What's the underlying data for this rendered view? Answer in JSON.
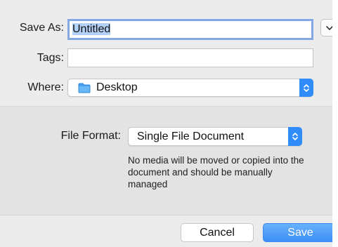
{
  "dialog": {
    "save_as_label": "Save As:",
    "save_as_value": "Untitled",
    "tags_label": "Tags:",
    "tags_value": "",
    "where_label": "Where:",
    "where_value": "Desktop",
    "where_icon": "folder-icon"
  },
  "options": {
    "file_format_label": "File Format:",
    "file_format_value": "Single File Document",
    "note": "No media will be moved or copied into the document and should be manually managed"
  },
  "buttons": {
    "cancel_label": "Cancel",
    "save_label": "Save"
  },
  "colors": {
    "accent": "#2f8cf9",
    "focus_ring": "#83a8e4",
    "selection": "#b3d0f6",
    "folder": "#4aa3f0"
  }
}
